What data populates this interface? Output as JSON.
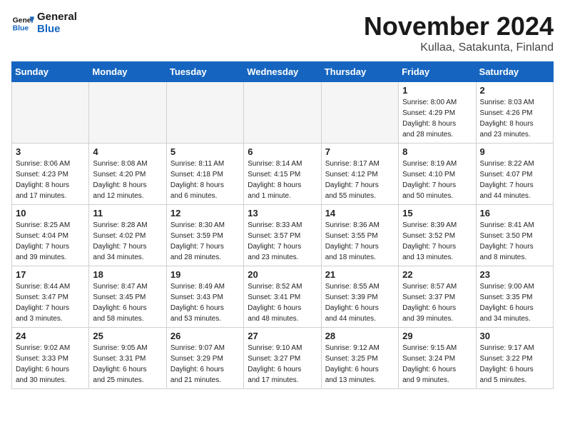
{
  "header": {
    "logo_line1": "General",
    "logo_line2": "Blue",
    "title": "November 2024",
    "subtitle": "Kullaa, Satakunta, Finland"
  },
  "weekdays": [
    "Sunday",
    "Monday",
    "Tuesday",
    "Wednesday",
    "Thursday",
    "Friday",
    "Saturday"
  ],
  "weeks": [
    [
      {
        "day": "",
        "info": ""
      },
      {
        "day": "",
        "info": ""
      },
      {
        "day": "",
        "info": ""
      },
      {
        "day": "",
        "info": ""
      },
      {
        "day": "",
        "info": ""
      },
      {
        "day": "1",
        "info": "Sunrise: 8:00 AM\nSunset: 4:29 PM\nDaylight: 8 hours\nand 28 minutes."
      },
      {
        "day": "2",
        "info": "Sunrise: 8:03 AM\nSunset: 4:26 PM\nDaylight: 8 hours\nand 23 minutes."
      }
    ],
    [
      {
        "day": "3",
        "info": "Sunrise: 8:06 AM\nSunset: 4:23 PM\nDaylight: 8 hours\nand 17 minutes."
      },
      {
        "day": "4",
        "info": "Sunrise: 8:08 AM\nSunset: 4:20 PM\nDaylight: 8 hours\nand 12 minutes."
      },
      {
        "day": "5",
        "info": "Sunrise: 8:11 AM\nSunset: 4:18 PM\nDaylight: 8 hours\nand 6 minutes."
      },
      {
        "day": "6",
        "info": "Sunrise: 8:14 AM\nSunset: 4:15 PM\nDaylight: 8 hours\nand 1 minute."
      },
      {
        "day": "7",
        "info": "Sunrise: 8:17 AM\nSunset: 4:12 PM\nDaylight: 7 hours\nand 55 minutes."
      },
      {
        "day": "8",
        "info": "Sunrise: 8:19 AM\nSunset: 4:10 PM\nDaylight: 7 hours\nand 50 minutes."
      },
      {
        "day": "9",
        "info": "Sunrise: 8:22 AM\nSunset: 4:07 PM\nDaylight: 7 hours\nand 44 minutes."
      }
    ],
    [
      {
        "day": "10",
        "info": "Sunrise: 8:25 AM\nSunset: 4:04 PM\nDaylight: 7 hours\nand 39 minutes."
      },
      {
        "day": "11",
        "info": "Sunrise: 8:28 AM\nSunset: 4:02 PM\nDaylight: 7 hours\nand 34 minutes."
      },
      {
        "day": "12",
        "info": "Sunrise: 8:30 AM\nSunset: 3:59 PM\nDaylight: 7 hours\nand 28 minutes."
      },
      {
        "day": "13",
        "info": "Sunrise: 8:33 AM\nSunset: 3:57 PM\nDaylight: 7 hours\nand 23 minutes."
      },
      {
        "day": "14",
        "info": "Sunrise: 8:36 AM\nSunset: 3:55 PM\nDaylight: 7 hours\nand 18 minutes."
      },
      {
        "day": "15",
        "info": "Sunrise: 8:39 AM\nSunset: 3:52 PM\nDaylight: 7 hours\nand 13 minutes."
      },
      {
        "day": "16",
        "info": "Sunrise: 8:41 AM\nSunset: 3:50 PM\nDaylight: 7 hours\nand 8 minutes."
      }
    ],
    [
      {
        "day": "17",
        "info": "Sunrise: 8:44 AM\nSunset: 3:47 PM\nDaylight: 7 hours\nand 3 minutes."
      },
      {
        "day": "18",
        "info": "Sunrise: 8:47 AM\nSunset: 3:45 PM\nDaylight: 6 hours\nand 58 minutes."
      },
      {
        "day": "19",
        "info": "Sunrise: 8:49 AM\nSunset: 3:43 PM\nDaylight: 6 hours\nand 53 minutes."
      },
      {
        "day": "20",
        "info": "Sunrise: 8:52 AM\nSunset: 3:41 PM\nDaylight: 6 hours\nand 48 minutes."
      },
      {
        "day": "21",
        "info": "Sunrise: 8:55 AM\nSunset: 3:39 PM\nDaylight: 6 hours\nand 44 minutes."
      },
      {
        "day": "22",
        "info": "Sunrise: 8:57 AM\nSunset: 3:37 PM\nDaylight: 6 hours\nand 39 minutes."
      },
      {
        "day": "23",
        "info": "Sunrise: 9:00 AM\nSunset: 3:35 PM\nDaylight: 6 hours\nand 34 minutes."
      }
    ],
    [
      {
        "day": "24",
        "info": "Sunrise: 9:02 AM\nSunset: 3:33 PM\nDaylight: 6 hours\nand 30 minutes."
      },
      {
        "day": "25",
        "info": "Sunrise: 9:05 AM\nSunset: 3:31 PM\nDaylight: 6 hours\nand 25 minutes."
      },
      {
        "day": "26",
        "info": "Sunrise: 9:07 AM\nSunset: 3:29 PM\nDaylight: 6 hours\nand 21 minutes."
      },
      {
        "day": "27",
        "info": "Sunrise: 9:10 AM\nSunset: 3:27 PM\nDaylight: 6 hours\nand 17 minutes."
      },
      {
        "day": "28",
        "info": "Sunrise: 9:12 AM\nSunset: 3:25 PM\nDaylight: 6 hours\nand 13 minutes."
      },
      {
        "day": "29",
        "info": "Sunrise: 9:15 AM\nSunset: 3:24 PM\nDaylight: 6 hours\nand 9 minutes."
      },
      {
        "day": "30",
        "info": "Sunrise: 9:17 AM\nSunset: 3:22 PM\nDaylight: 6 hours\nand 5 minutes."
      }
    ]
  ]
}
